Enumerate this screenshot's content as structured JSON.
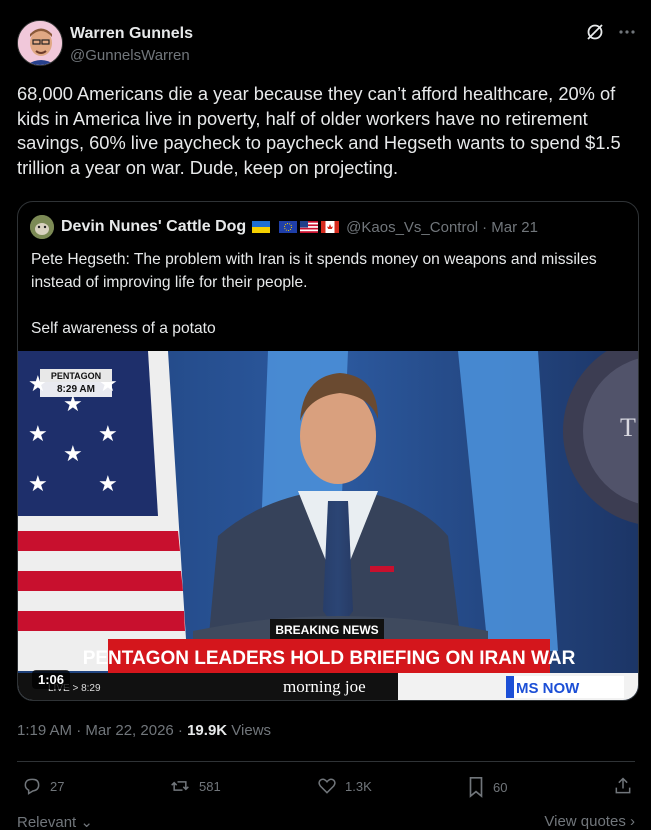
{
  "header": {
    "name": "Warren Gunnels",
    "handle": "@GunnelsWarren",
    "icons": [
      "grok-icon",
      "more-icon"
    ]
  },
  "tweet": {
    "text": "68,000 Americans die a year because they can’t afford healthcare, 20% of kids in America live in poverty, half of older workers have no retirement savings, 60% live paycheck to paycheck and Hegseth wants to spend $1.5 trillion a year on war. Dude, keep on projecting."
  },
  "quote": {
    "name": "Devin Nunes' Cattle Dog",
    "flags": [
      "ukraine-flag",
      "eu-flag",
      "us-flag",
      "canada-flag"
    ],
    "handle": "@Kaos_Vs_Control",
    "date": "· Mar 21",
    "text": "Pete Hegseth: The problem with Iran is it spends money on weapons and missiles instead of improving life for their people.\n\nSelf awareness of a potato"
  },
  "video": {
    "bug_line1": "PENTAGON",
    "bug_line2": "8:29 AM",
    "breaking": "BREAKING NEWS",
    "headline": "PENTAGON LEADERS HOLD BRIEFING ON IRAN WAR",
    "ticker_time": "LIVE > 8:29",
    "show": "morning joe",
    "network": "MS NOW",
    "duration": "1:06",
    "wall_letter": "T"
  },
  "meta": {
    "time": "1:19 AM · Mar 22, 2026 · ",
    "views_count": "19.9K",
    "views_label": " Views"
  },
  "actions": {
    "replies": "27",
    "reposts": "581",
    "likes": "1.3K",
    "bookmarks": "60"
  },
  "bottom": {
    "left": "Relevant",
    "right": "View quotes"
  },
  "colors": {
    "background": "#000000",
    "text": "#e7e9ea",
    "muted": "#71767b",
    "border": "#2f3336",
    "breaking_red": "#d4161c"
  }
}
